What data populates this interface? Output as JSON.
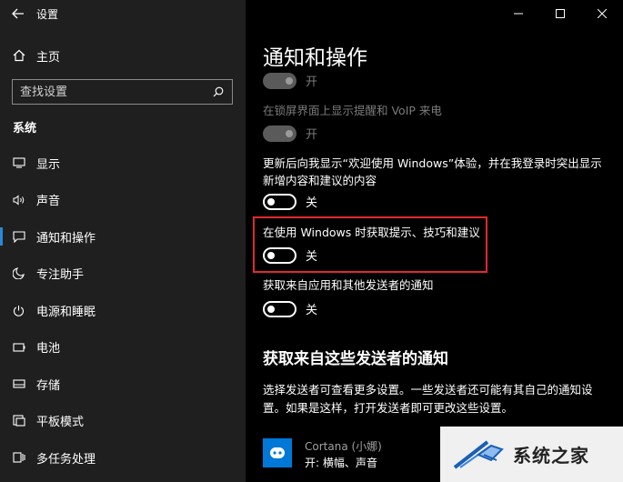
{
  "window": {
    "title": "设置",
    "controls": {
      "minimize": "—",
      "maximize": "☐",
      "close": "✕"
    }
  },
  "sidebar": {
    "home_label": "主页",
    "search_placeholder": "查找设置",
    "section_label": "系统",
    "items": [
      {
        "label": "显示",
        "icon": "monitor-icon"
      },
      {
        "label": "声音",
        "icon": "speaker-icon"
      },
      {
        "label": "通知和操作",
        "icon": "notification-icon",
        "active": true
      },
      {
        "label": "专注助手",
        "icon": "moon-icon"
      },
      {
        "label": "电源和睡眠",
        "icon": "power-icon"
      },
      {
        "label": "电池",
        "icon": "battery-icon"
      },
      {
        "label": "存储",
        "icon": "storage-icon"
      },
      {
        "label": "平板模式",
        "icon": "tablet-icon"
      },
      {
        "label": "多任务处理",
        "icon": "multitask-icon"
      }
    ]
  },
  "main": {
    "title": "通知和操作",
    "settings": [
      {
        "label": "",
        "state": "开",
        "on": true,
        "disabled": true
      },
      {
        "label": "在锁屏界面上显示提醒和 VoIP 来电",
        "state": "开",
        "on": true,
        "disabled": true
      },
      {
        "label": "更新后向我显示“欢迎使用 Windows”体验，并在我登录时突出显示新增内容和建议的内容",
        "state": "关",
        "on": false
      },
      {
        "label": "在使用 Windows 时获取提示、技巧和建议",
        "state": "关",
        "on": false,
        "highlighted": true
      },
      {
        "label": "获取来自应用和其他发送者的通知",
        "state": "关",
        "on": false
      }
    ],
    "senders_heading": "获取来自这些发送者的通知",
    "senders_description": "选择发送者可查看更多设置。一些发送者还可能有其自己的通知设置。如果是这样，打开发送者即可更改这些设置。",
    "senders": [
      {
        "name": "Cortana (小娜)",
        "detail": "开: 横幅、声音"
      }
    ]
  },
  "watermark": {
    "text": "系统之家"
  },
  "colors": {
    "accent": "#2b88d8",
    "highlight": "#e0282f",
    "sidebar_bg": "#1f1f1f",
    "main_bg": "#000000"
  }
}
